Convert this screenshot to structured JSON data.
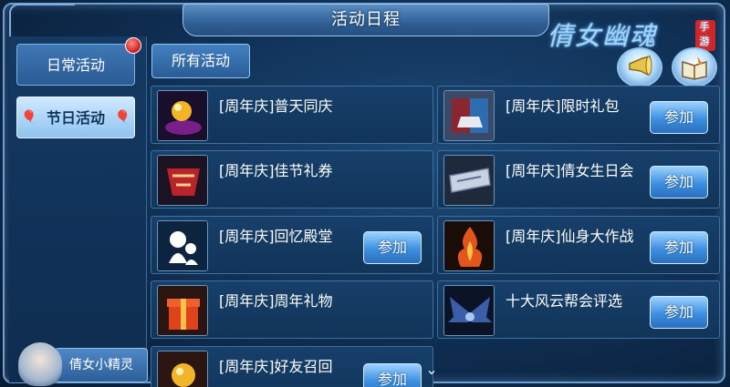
{
  "window": {
    "title": "活动日程"
  },
  "sidebar": {
    "tabs": [
      {
        "label": "日常活动",
        "has_alert": true
      },
      {
        "label": "节日活动",
        "selected": true
      }
    ],
    "spirit_label": "倩女小精灵"
  },
  "branding": {
    "logo_text": "倩女幽魂",
    "stamp_text": "手游"
  },
  "toolbar": {
    "horn_icon": "horn-icon",
    "book_icon": "book-icon"
  },
  "filter": {
    "all_label": "所有活动"
  },
  "activities": {
    "left": [
      {
        "title": "[周年庆]普天同庆",
        "join_label": ""
      },
      {
        "title": "[周年庆]佳节礼券",
        "join_label": ""
      },
      {
        "title": "[周年庆]回忆殿堂",
        "join_label": "参加"
      },
      {
        "title": "[周年庆]周年礼物",
        "join_label": ""
      },
      {
        "title": "[周年庆]好友召回",
        "join_label": "参加"
      }
    ],
    "right": [
      {
        "title": "[周年庆]限时礼包",
        "join_label": "参加"
      },
      {
        "title": "[周年庆]倩女生日会",
        "join_label": "参加"
      },
      {
        "title": "[周年庆]仙身大作战",
        "join_label": "参加"
      },
      {
        "title": "十大风云帮会评选",
        "join_label": "参加"
      }
    ]
  },
  "colors": {
    "panel_bg": "#0f2e52",
    "button_blue": "#3d8fe0",
    "alert_red": "#d01818"
  }
}
